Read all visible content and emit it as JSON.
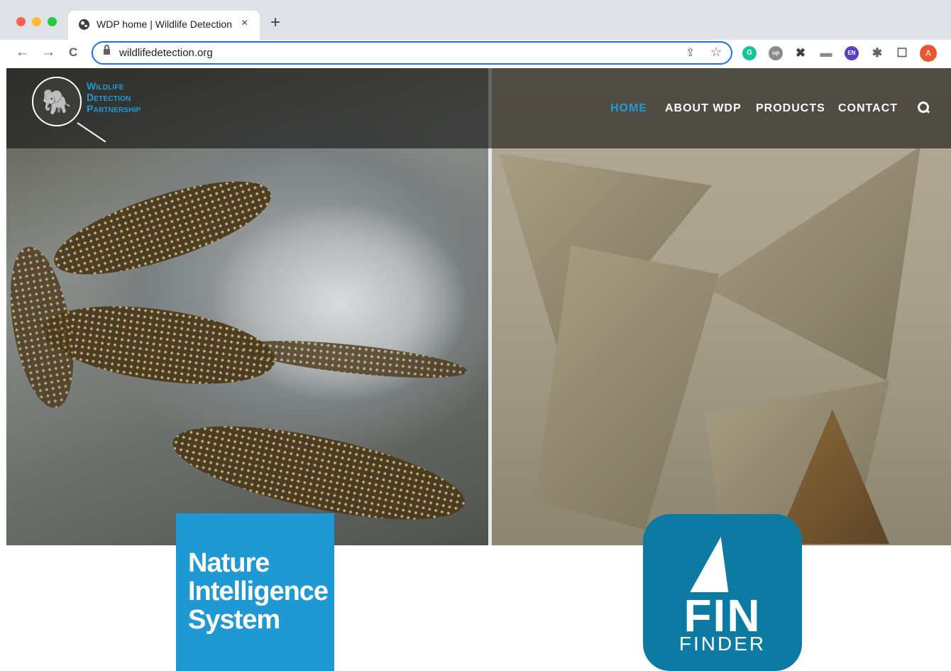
{
  "browser": {
    "tab_title": "WDP home | Wildlife Detection",
    "tab_close": "×",
    "new_tab": "+",
    "back": "←",
    "forward": "→",
    "reload": "C",
    "url": "wildlifedetection.org",
    "share": "⇪",
    "star": "☆",
    "extensions": [
      {
        "name": "grammarly-icon",
        "glyph": "G",
        "color": "#15c39a"
      },
      {
        "name": "upwork-icon",
        "glyph": "up",
        "color": "#8a8a8a"
      },
      {
        "name": "cross-extension-icon",
        "glyph": "✖",
        "color": "#3c4043"
      },
      {
        "name": "card-extension-icon",
        "glyph": "▬",
        "color": "#8a8a8a"
      },
      {
        "name": "en-extension-icon",
        "glyph": "EN",
        "color": "#5b3fc4"
      },
      {
        "name": "puzzle-icon",
        "glyph": "✱",
        "color": "#5f6368"
      },
      {
        "name": "side-panel-icon",
        "glyph": "☐",
        "color": "#5f6368"
      }
    ],
    "avatar_letter": "A"
  },
  "site": {
    "logo_lines": [
      "Wildlife",
      "Detection",
      "Partnership"
    ],
    "logo_glyph": "🐘",
    "nav": [
      {
        "label": "HOME",
        "active": true
      },
      {
        "label": "ABOUT WDP",
        "active": false
      },
      {
        "label": "PRODUCTS",
        "active": false
      },
      {
        "label": "CONTACT",
        "active": false
      }
    ],
    "accent_color": "#1f9ad6",
    "hero_left": "lizards",
    "hero_right": "shark fins"
  },
  "products": {
    "nis": {
      "lines": [
        "Nature",
        "Intelligence",
        "System"
      ],
      "color": "#1f99d4"
    },
    "fin": {
      "word": "FIN",
      "sub": "FINDER",
      "color": "#0d7aa3"
    }
  }
}
